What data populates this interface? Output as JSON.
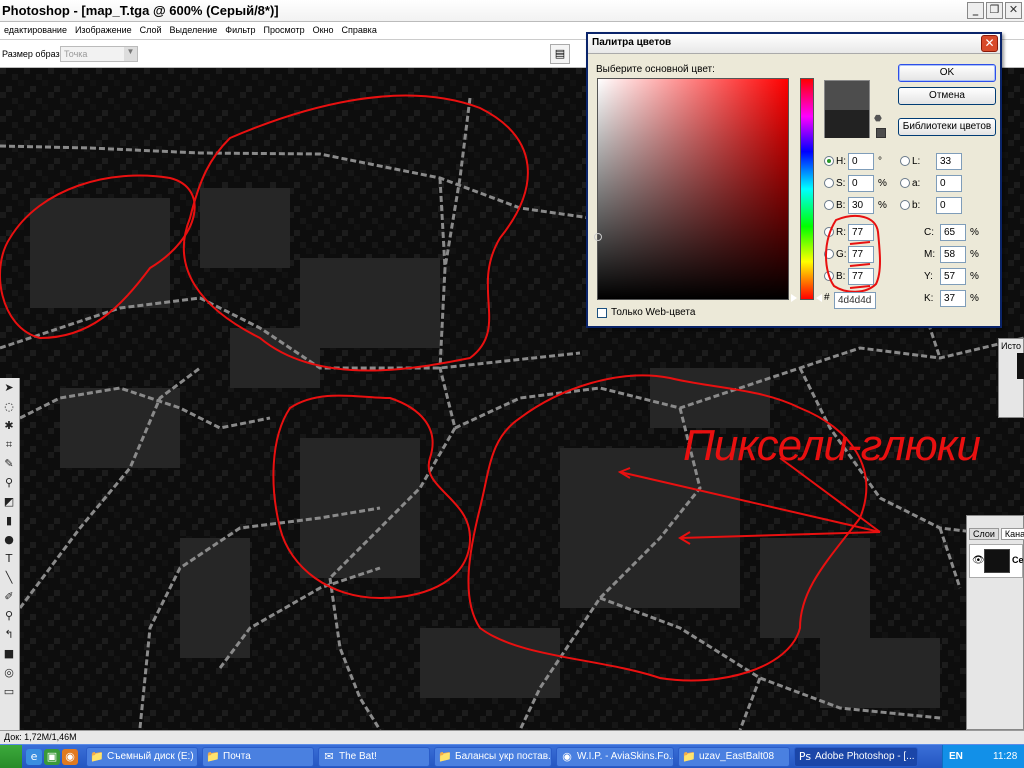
{
  "window": {
    "title": "Photoshop - [map_T.tga @ 600% (Серый/8*)]",
    "min_icon": "minimize-icon",
    "max_icon": "restore-icon",
    "close_icon": "close-icon"
  },
  "menu": [
    "едактирование",
    "Изображение",
    "Слой",
    "Выделение",
    "Фильтр",
    "Просмотр",
    "Окно",
    "Справка"
  ],
  "options_bar": {
    "sample_label": "Размер образца:",
    "sample_value": "Точка"
  },
  "canvas": {
    "annotation_text": "Пиксели-глюки",
    "annotation_color": "#e81010"
  },
  "status": {
    "doc": "Док: 1,72M/1,46M"
  },
  "color_picker": {
    "title": "Палитра цветов",
    "prompt": "Выберите основной цвет:",
    "buttons": {
      "ok": "OK",
      "cancel": "Отмена",
      "libraries": "Библиотеки цветов"
    },
    "new_color": "#4d4d4d",
    "old_color": "#222222",
    "hsb": {
      "h": {
        "label": "H:",
        "value": "0",
        "unit": "°"
      },
      "s": {
        "label": "S:",
        "value": "0",
        "unit": "%"
      },
      "b": {
        "label": "B:",
        "value": "30",
        "unit": "%"
      }
    },
    "rgb": {
      "r": {
        "label": "R:",
        "value": "77"
      },
      "g": {
        "label": "G:",
        "value": "77"
      },
      "b": {
        "label": "B:",
        "value": "77"
      }
    },
    "lab": {
      "l": {
        "label": "L:",
        "value": "33"
      },
      "a": {
        "label": "a:",
        "value": "0"
      },
      "b": {
        "label": "b:",
        "value": "0"
      }
    },
    "cmyk": {
      "c": {
        "label": "C:",
        "value": "65",
        "unit": "%"
      },
      "m": {
        "label": "M:",
        "value": "58",
        "unit": "%"
      },
      "y": {
        "label": "Y:",
        "value": "57",
        "unit": "%"
      },
      "k": {
        "label": "K:",
        "value": "37",
        "unit": "%"
      }
    },
    "hex_label": "#",
    "hex": "4d4d4d",
    "web_only": "Только Web-цвета"
  },
  "panels": {
    "history_tab": "Исто",
    "layers_tabs": [
      "Слои",
      "Канал"
    ],
    "layer_name": "Серый"
  },
  "taskbar": {
    "tasks": [
      {
        "label": "Съемный диск (E:)",
        "icon": "folder-icon"
      },
      {
        "label": "Почта",
        "icon": "folder-icon"
      },
      {
        "label": "The Bat!",
        "icon": "bat-icon"
      },
      {
        "label": "Балансы укр постав...",
        "icon": "folder-icon"
      },
      {
        "label": "W.I.P. - AviaSkins.Fo...",
        "icon": "browser-icon"
      },
      {
        "label": "uzav_EastBalt08",
        "icon": "folder-icon"
      },
      {
        "label": "Adobe Photoshop - [...",
        "icon": "photoshop-icon"
      }
    ],
    "lang": "EN",
    "clock": "11:28"
  }
}
